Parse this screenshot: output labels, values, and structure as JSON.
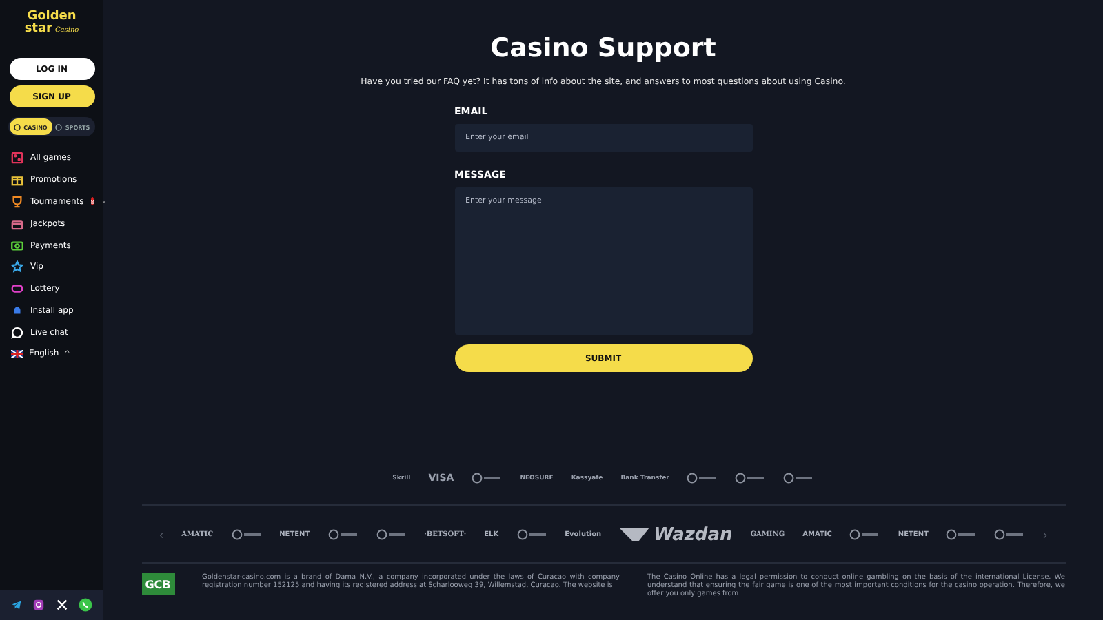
{
  "sidebar": {
    "logo": {
      "line1": "Golden",
      "line2": "star",
      "script": "Casino"
    },
    "login": "LOG IN",
    "signup": "SIGN UP",
    "switch": [
      {
        "label": "CASINO",
        "selected": true
      },
      {
        "label": "SPORTS",
        "selected": false
      }
    ],
    "items": [
      {
        "label": "All games",
        "kind": "dice",
        "color": "#e0335a"
      },
      {
        "label": "Promotions",
        "kind": "gift",
        "color": "#e8c13a"
      },
      {
        "label": "Tournaments",
        "kind": "trophy",
        "color": "#f08a24",
        "badge": "8",
        "caret": "⌄"
      },
      {
        "label": "Jackpots",
        "kind": "chest",
        "color": "#d96a8a"
      },
      {
        "label": "Payments",
        "kind": "cash",
        "color": "#5ccf3b"
      },
      {
        "label": "Vip",
        "kind": "star",
        "color": "#3aa8e8"
      },
      {
        "label": "Lottery",
        "kind": "ticket",
        "color": "#e040c8"
      },
      {
        "label": "Install app",
        "kind": "android",
        "color": "#3a7be8"
      },
      {
        "label": "Live chat",
        "kind": "chat",
        "color": "#ffffff"
      }
    ],
    "language": {
      "label": "English",
      "caret": "^"
    },
    "social": [
      {
        "kind": "telegram"
      },
      {
        "kind": "instagram"
      },
      {
        "kind": "x"
      },
      {
        "kind": "whatsapp"
      }
    ]
  },
  "main": {
    "title": "Casino Support",
    "intro": "Have you tried our FAQ yet? It has tons of info about the site, and answers to most questions about using Casino.",
    "email": {
      "label": "EMAIL",
      "placeholder": "Enter your email"
    },
    "message": {
      "label": "MESSAGE",
      "placeholder": "Enter your message"
    },
    "submit": "SUBMIT"
  },
  "payments": [
    {
      "kind": "text",
      "label": "Skrill"
    },
    {
      "kind": "bigtext",
      "label": "VISA"
    },
    {
      "kind": "mark"
    },
    {
      "kind": "text",
      "label": "NEOSURF"
    },
    {
      "kind": "text",
      "label": "Kassyafe"
    },
    {
      "kind": "text",
      "label": "Bank Transfer"
    },
    {
      "kind": "mark"
    },
    {
      "kind": "mark"
    },
    {
      "kind": "mark"
    }
  ],
  "providers": {
    "prev": "‹",
    "next": "›",
    "items": [
      {
        "kind": "text",
        "label": "AMATIC"
      },
      {
        "kind": "mark"
      },
      {
        "kind": "text",
        "label": "NETENT"
      },
      {
        "kind": "mark"
      },
      {
        "kind": "mark"
      },
      {
        "kind": "text",
        "label": "·BETSOFT·"
      },
      {
        "kind": "text",
        "label": "ELK"
      },
      {
        "kind": "mark"
      },
      {
        "kind": "text",
        "label": "Evolution"
      },
      {
        "kind": "wazdan",
        "label": "Wazdan"
      },
      {
        "kind": "text",
        "label": "GAMING"
      },
      {
        "kind": "text",
        "label": "AMATIC"
      },
      {
        "kind": "mark"
      },
      {
        "kind": "text",
        "label": "NETENT"
      },
      {
        "kind": "mark"
      },
      {
        "kind": "mark"
      }
    ]
  },
  "footer": {
    "badge": "GCB",
    "left": "Goldenstar-casino.com is a brand of Dama N.V., a company incorporated under the laws of Curacao with company registration number 152125 and having its registered address at Scharlooweg 39, Willemstad, Curaçao. The website is",
    "right": "The Casino Online has a legal permission to conduct online gambling on the basis of the international License. We understand that ensuring the fair game is one of the most important conditions for the casino operation. Therefore, we offer you only games from"
  }
}
